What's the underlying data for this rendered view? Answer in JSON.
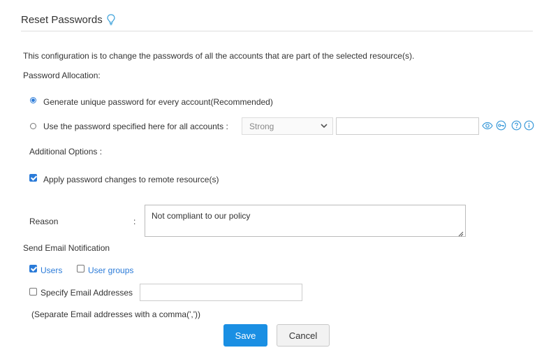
{
  "header": {
    "title": "Reset Passwords",
    "icon": "lightbulb-icon"
  },
  "description": "This configuration is to change the passwords of all the accounts that are part of the selected resource(s).",
  "password_allocation": {
    "label": "Password Allocation:",
    "option_unique": "Generate unique password for every account(Recommended)",
    "option_specified": "Use the password specified here for all accounts :",
    "selected": "unique",
    "policy_select_value": "Strong",
    "password_value": ""
  },
  "additional_options": {
    "label": "Additional Options :",
    "apply_remote": "Apply password changes to remote resource(s)",
    "apply_remote_checked": true
  },
  "reason": {
    "label": "Reason",
    "colon": ":",
    "value": "Not compliant to our policy"
  },
  "email_notification": {
    "label": "Send Email Notification",
    "users_label": "Users",
    "users_checked": true,
    "user_groups_label": "User groups",
    "user_groups_checked": false,
    "specify_label": "Specify Email Addresses",
    "specify_checked": false,
    "specify_value": "",
    "hint": "(Separate Email addresses with a comma(','))"
  },
  "actions": {
    "save": "Save",
    "cancel": "Cancel"
  },
  "colors": {
    "accent": "#2b7bd8",
    "save_button": "#1a8fe3"
  }
}
